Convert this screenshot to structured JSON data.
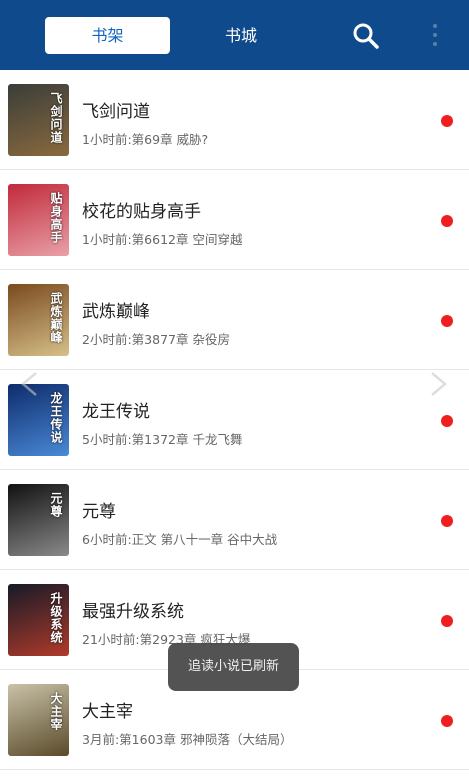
{
  "topbar": {
    "tab_shelf": "书架",
    "tab_store": "书城",
    "search_icon": "search-icon",
    "more_icon": "more-vertical-icon"
  },
  "books": [
    {
      "title": "飞剑问道",
      "update": "1小时前:第69章 威胁?",
      "cover_text": "飞剑问道",
      "colors": [
        "#3a3d3a",
        "#8a6a3d"
      ]
    },
    {
      "title": "校花的贴身高手",
      "update": "1小时前:第6612章 空间穿越",
      "cover_text": "贴身高手",
      "colors": [
        "#c12a3a",
        "#e9a0a8"
      ]
    },
    {
      "title": "武炼巅峰",
      "update": "2小时前:第3877章 杂役房",
      "cover_text": "武炼巅峰",
      "colors": [
        "#7a4a1e",
        "#d6c08a"
      ]
    },
    {
      "title": "龙王传说",
      "update": "5小时前:第1372章 千龙飞舞",
      "cover_text": "龙王传说",
      "colors": [
        "#0e2b6b",
        "#4a8ad6"
      ]
    },
    {
      "title": "元尊",
      "update": "6小时前:正文 第八十一章  谷中大战",
      "cover_text": "元尊",
      "colors": [
        "#111111",
        "#8a8a8a"
      ]
    },
    {
      "title": "最强升级系统",
      "update": "21小时前:第2923章 疯狂大爆",
      "cover_text": "升级系统",
      "colors": [
        "#151a28",
        "#b23a2a"
      ]
    },
    {
      "title": "大主宰",
      "update": "3月前:第1603章 邪神陨落（大结局）",
      "cover_text": "大主宰",
      "colors": [
        "#c9c2a8",
        "#5a4a2a"
      ]
    }
  ],
  "status_color": "#ef1f1f",
  "toast": "追读小说已刷新"
}
